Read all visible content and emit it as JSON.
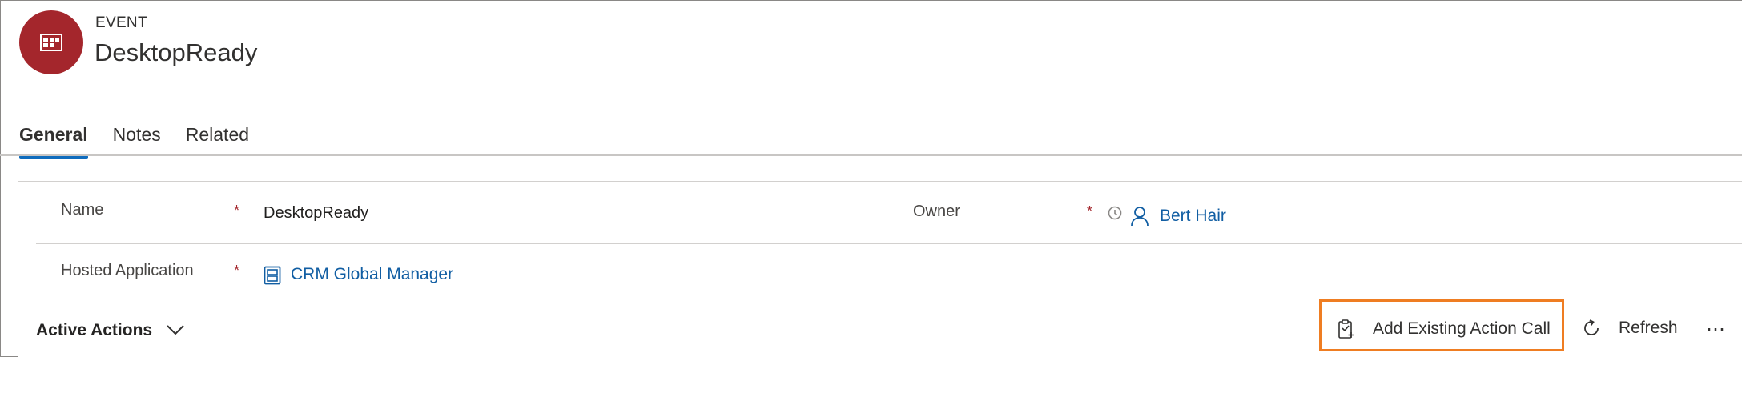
{
  "header": {
    "entity_type": "EVENT",
    "title": "DesktopReady",
    "icon": "event-grid-icon",
    "icon_color": "#a4262c"
  },
  "tabs": [
    {
      "label": "General",
      "active": true
    },
    {
      "label": "Notes",
      "active": false
    },
    {
      "label": "Related",
      "active": false
    }
  ],
  "form": {
    "name": {
      "label": "Name",
      "required": "*",
      "value": "DesktopReady"
    },
    "owner": {
      "label": "Owner",
      "required": "*",
      "value": "Bert Hair"
    },
    "hosted_application": {
      "label": "Hosted Application",
      "required": "*",
      "value": "CRM Global Manager"
    }
  },
  "subgrid": {
    "title": "Active Actions",
    "commands": {
      "add_existing": "Add Existing Action Call",
      "refresh": "Refresh",
      "more": "⋯"
    }
  },
  "colors": {
    "accent": "#0f6cbd",
    "link": "#115ea3",
    "required": "#a4262c",
    "highlight": "#ef7d22"
  }
}
